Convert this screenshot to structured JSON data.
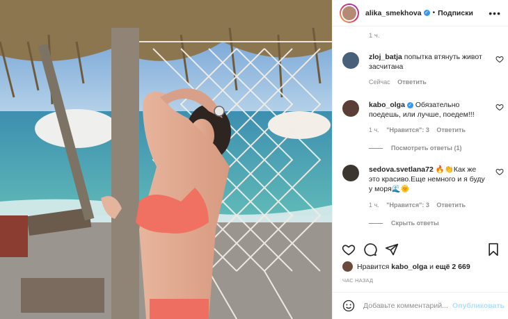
{
  "header": {
    "username": "alika_smekhova",
    "separator": "•",
    "follow_label": "Подписки",
    "more_label": "•••"
  },
  "comments": {
    "top_time": "1 ч.",
    "items": [
      {
        "username": "zloj_batja",
        "text": "попытка втянуть живот засчитана",
        "time": "Сейчас",
        "reply_label": "Ответить"
      },
      {
        "username": "kabo_olga",
        "verified": true,
        "text": "Обязательно поедешь, или лучше, поедем!!!",
        "time": "1 ч.",
        "likes": "\"Нравится\": 3",
        "reply_label": "Ответить",
        "thread_label": "Посмотреть ответы (1)"
      },
      {
        "username": "sedova.svetlana72",
        "text": "🔥👏Как же это красиво.Еще немного и я буду у моря🌊🌞",
        "time": "1 ч.",
        "likes": "\"Нравится\": 3",
        "reply_label": "Ответить",
        "thread_label": "Скрыть ответы"
      }
    ]
  },
  "likes": {
    "prefix": "Нравится",
    "user": "kabo_olga",
    "middle": "и",
    "others": "ещё 2 669"
  },
  "timestamp": "ЧАС НАЗАД",
  "add_comment": {
    "placeholder": "Добавьте комментарий...",
    "publish_label": "Опубликовать"
  },
  "icons": [
    "heart-icon",
    "comment-icon",
    "share-icon",
    "bookmark-icon",
    "emoji-icon",
    "more-icon",
    "verified-icon"
  ],
  "colors": {
    "link_blue": "#3897f0",
    "publish_disabled": "#b2dffc",
    "muted": "#8e8e8e"
  }
}
